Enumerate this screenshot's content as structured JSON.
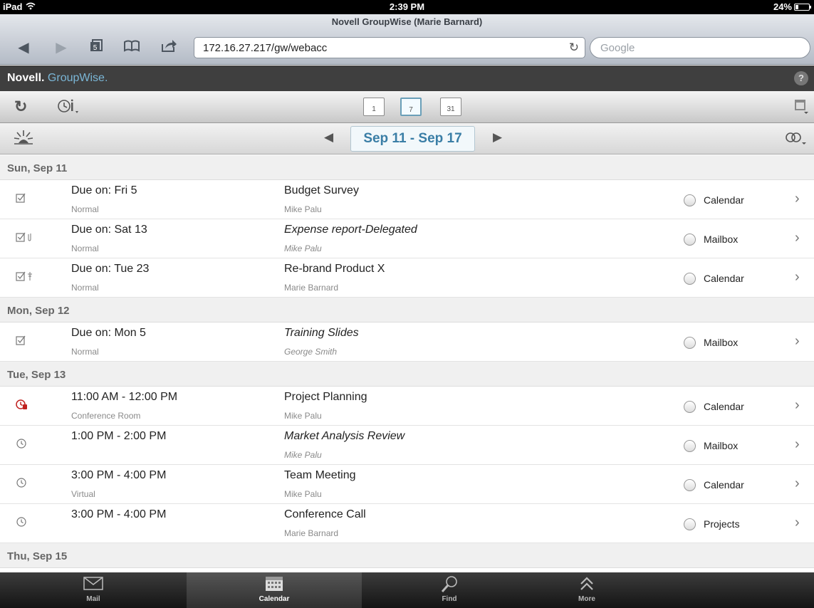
{
  "status": {
    "device": "iPad",
    "time": "2:39 PM",
    "battery": "24%"
  },
  "browser": {
    "title": "Novell GroupWise (Marie Barnard)",
    "url": "172.16.27.217/gw/webacc",
    "search_placeholder": "Google",
    "tabs_count": "5"
  },
  "app": {
    "brand_novell": "Novell.",
    "brand_gw": "GroupWise.",
    "help": "?"
  },
  "views": {
    "day": "1",
    "week": "7",
    "month": "31"
  },
  "range": "Sep 11 - Sep 17",
  "days": [
    {
      "label": "Sun, Sep 11",
      "items": [
        {
          "icon": "task-icon",
          "when": "Due on: Fri 5",
          "place": "Normal",
          "subject": "Budget Survey",
          "from": "Mike Palu",
          "folder": "Calendar",
          "italic": false
        },
        {
          "icon": "task-attachment-icon",
          "when": "Due on: Sat 13",
          "place": "Normal",
          "subject": "Expense report-Delegated",
          "from": "Mike Palu",
          "folder": "Mailbox",
          "italic": true
        },
        {
          "icon": "task-pinned-icon",
          "when": "Due on: Tue 23",
          "place": "Normal",
          "subject": "Re-brand Product X",
          "from": "Marie Barnard",
          "folder": "Calendar",
          "italic": false
        }
      ]
    },
    {
      "label": "Mon, Sep 12",
      "items": [
        {
          "icon": "task-icon",
          "when": "Due on: Mon 5",
          "place": "Normal",
          "subject": "Training Slides",
          "from": "George Smith",
          "folder": "Mailbox",
          "italic": true
        }
      ]
    },
    {
      "label": "Tue, Sep 13",
      "items": [
        {
          "icon": "appointment-urgent-icon",
          "when": "11:00 AM - 12:00 PM",
          "place": "Conference Room",
          "subject": "Project Planning",
          "from": "Mike Palu",
          "folder": "Calendar",
          "italic": false
        },
        {
          "icon": "appointment-icon",
          "when": "1:00 PM - 2:00 PM",
          "place": "",
          "subject": "Market Analysis Review",
          "from": "Mike Palu",
          "folder": "Mailbox",
          "italic": true
        },
        {
          "icon": "appointment-icon",
          "when": "3:00 PM - 4:00 PM",
          "place": "Virtual",
          "subject": "Team Meeting",
          "from": "Mike Palu",
          "folder": "Calendar",
          "italic": false
        },
        {
          "icon": "appointment-icon",
          "when": "3:00 PM - 4:00 PM",
          "place": "",
          "subject": "Conference Call",
          "from": "Marie Barnard",
          "folder": "Projects",
          "italic": false
        }
      ]
    },
    {
      "label": "Thu, Sep 15",
      "items": []
    }
  ],
  "tabbar": [
    {
      "label": "Mail",
      "icon": "mail-icon",
      "active": false
    },
    {
      "label": "Calendar",
      "icon": "calendar-icon",
      "active": true
    },
    {
      "label": "Find",
      "icon": "find-icon",
      "active": false
    },
    {
      "label": "More",
      "icon": "more-icon",
      "active": false
    }
  ]
}
